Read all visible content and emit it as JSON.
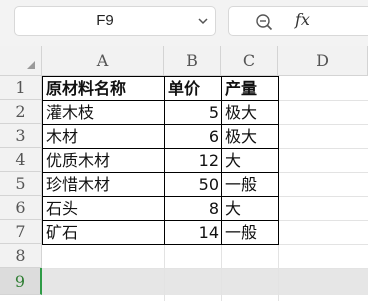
{
  "formula_bar": {
    "name_box": "F9",
    "zoom_icon": "zoom-icon",
    "fx_label": "fx"
  },
  "columns": [
    "A",
    "B",
    "C",
    "D"
  ],
  "rows": [
    "1",
    "2",
    "3",
    "4",
    "5",
    "6",
    "7",
    "8",
    "9"
  ],
  "selected_row": "9",
  "table": {
    "header": [
      "原材料名称",
      "单价",
      "产量"
    ],
    "rows": [
      [
        "灌木枝",
        "5",
        "极大"
      ],
      [
        "木材",
        "6",
        "极大"
      ],
      [
        "优质木材",
        "12",
        "大"
      ],
      [
        "珍惜木材",
        "50",
        "一般"
      ],
      [
        "石头",
        "8",
        "大"
      ],
      [
        "矿石",
        "14",
        "一般"
      ]
    ]
  }
}
